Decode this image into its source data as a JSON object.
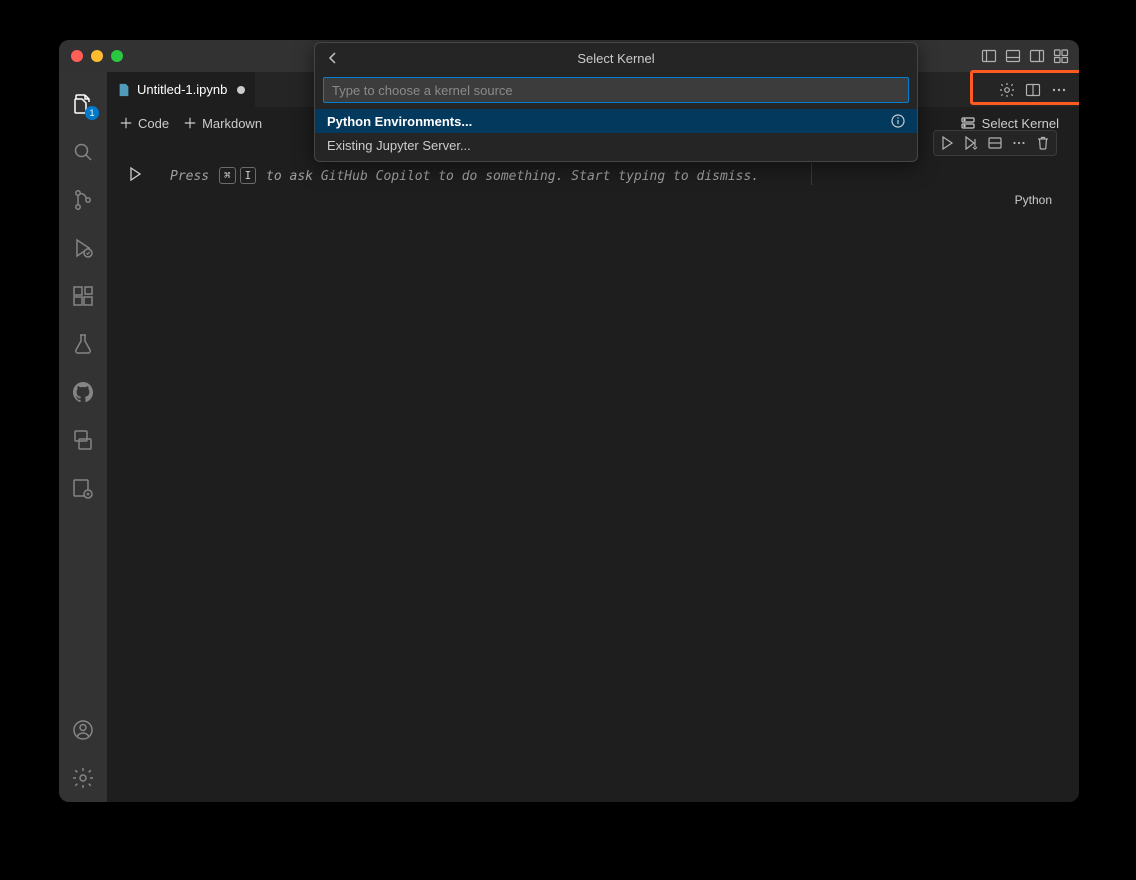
{
  "tab": {
    "filename": "Untitled-1.ipynb"
  },
  "toolbar": {
    "code_label": "Code",
    "markdown_label": "Markdown",
    "select_kernel_label": "Select Kernel"
  },
  "cell": {
    "hint_prefix": "Press ",
    "key1": "⌘",
    "key2": "I",
    "hint_suffix": " to ask GitHub Copilot to do something. Start typing to dismiss.",
    "language": "Python"
  },
  "activity": {
    "explorer_badge": "1"
  },
  "quickpick": {
    "title": "Select Kernel",
    "placeholder": "Type to choose a kernel source",
    "items": [
      {
        "label": "Python Environments...",
        "selected": true,
        "info": true
      },
      {
        "label": "Existing Jupyter Server...",
        "selected": false,
        "info": false
      }
    ]
  }
}
